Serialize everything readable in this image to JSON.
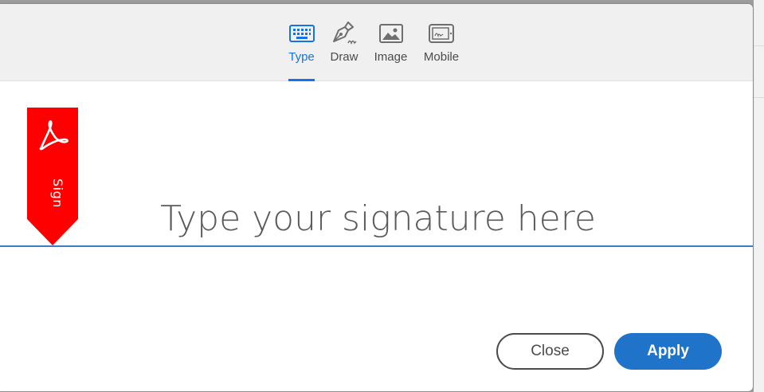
{
  "tabs": {
    "type": {
      "label": "Type",
      "icon": "keyboard-icon",
      "active": true
    },
    "draw": {
      "label": "Draw",
      "icon": "pen-icon"
    },
    "image": {
      "label": "Image",
      "icon": "image-icon"
    },
    "mobile": {
      "label": "Mobile",
      "icon": "mobile-icon"
    }
  },
  "badge": {
    "text": "Sign",
    "icon": "adobe-acrobat-icon",
    "color": "#ff0000"
  },
  "signature": {
    "placeholder": "Type your signature here",
    "value": ""
  },
  "buttons": {
    "close": "Close",
    "apply": "Apply"
  },
  "colors": {
    "accent": "#1473e6",
    "apply_bg": "#1f73c9",
    "baseline": "#3a7fc5"
  }
}
